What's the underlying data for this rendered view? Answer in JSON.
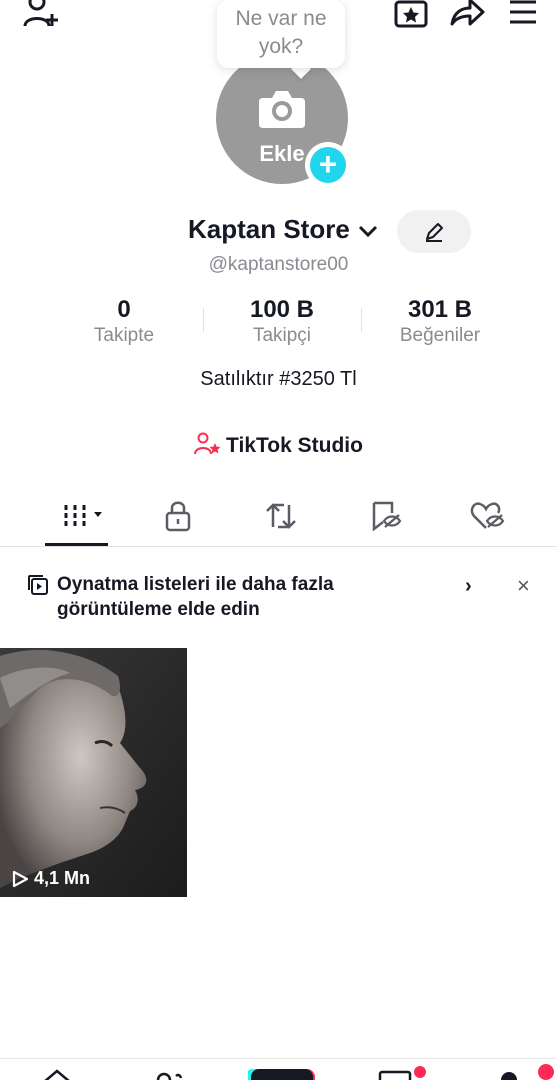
{
  "top_bar": {
    "icons": [
      "add-friend-icon",
      "favorites-icon",
      "share-icon",
      "menu-icon"
    ]
  },
  "bubble": {
    "line1": "Ne var ne",
    "line2": "yok?"
  },
  "avatar": {
    "label": "Ekle",
    "plus": "+"
  },
  "profile": {
    "name": "Kaptan Store",
    "handle": "@kaptanstore00",
    "bio": "Satılıktır #3250 Tl"
  },
  "stats": [
    {
      "value": "0",
      "label": "Takipte"
    },
    {
      "value": "100 B",
      "label": "Takipçi"
    },
    {
      "value": "301 B",
      "label": "Beğeniler"
    }
  ],
  "studio": {
    "label": "TikTok Studio"
  },
  "tabs": [
    "videos-tab",
    "private-tab",
    "reposts-tab",
    "saved-tab",
    "liked-tab"
  ],
  "banner": {
    "line1": "Oynatma listeleri ile daha fazla",
    "line2": "görüntüleme elde edin",
    "chevron": "›",
    "close": "×"
  },
  "videos": [
    {
      "views": "4,1 Mn"
    }
  ],
  "colors": {
    "accent_cyan": "#20d5ec",
    "accent_red": "#fe2c55",
    "text_primary": "#161823",
    "text_secondary": "#8a8b91"
  }
}
